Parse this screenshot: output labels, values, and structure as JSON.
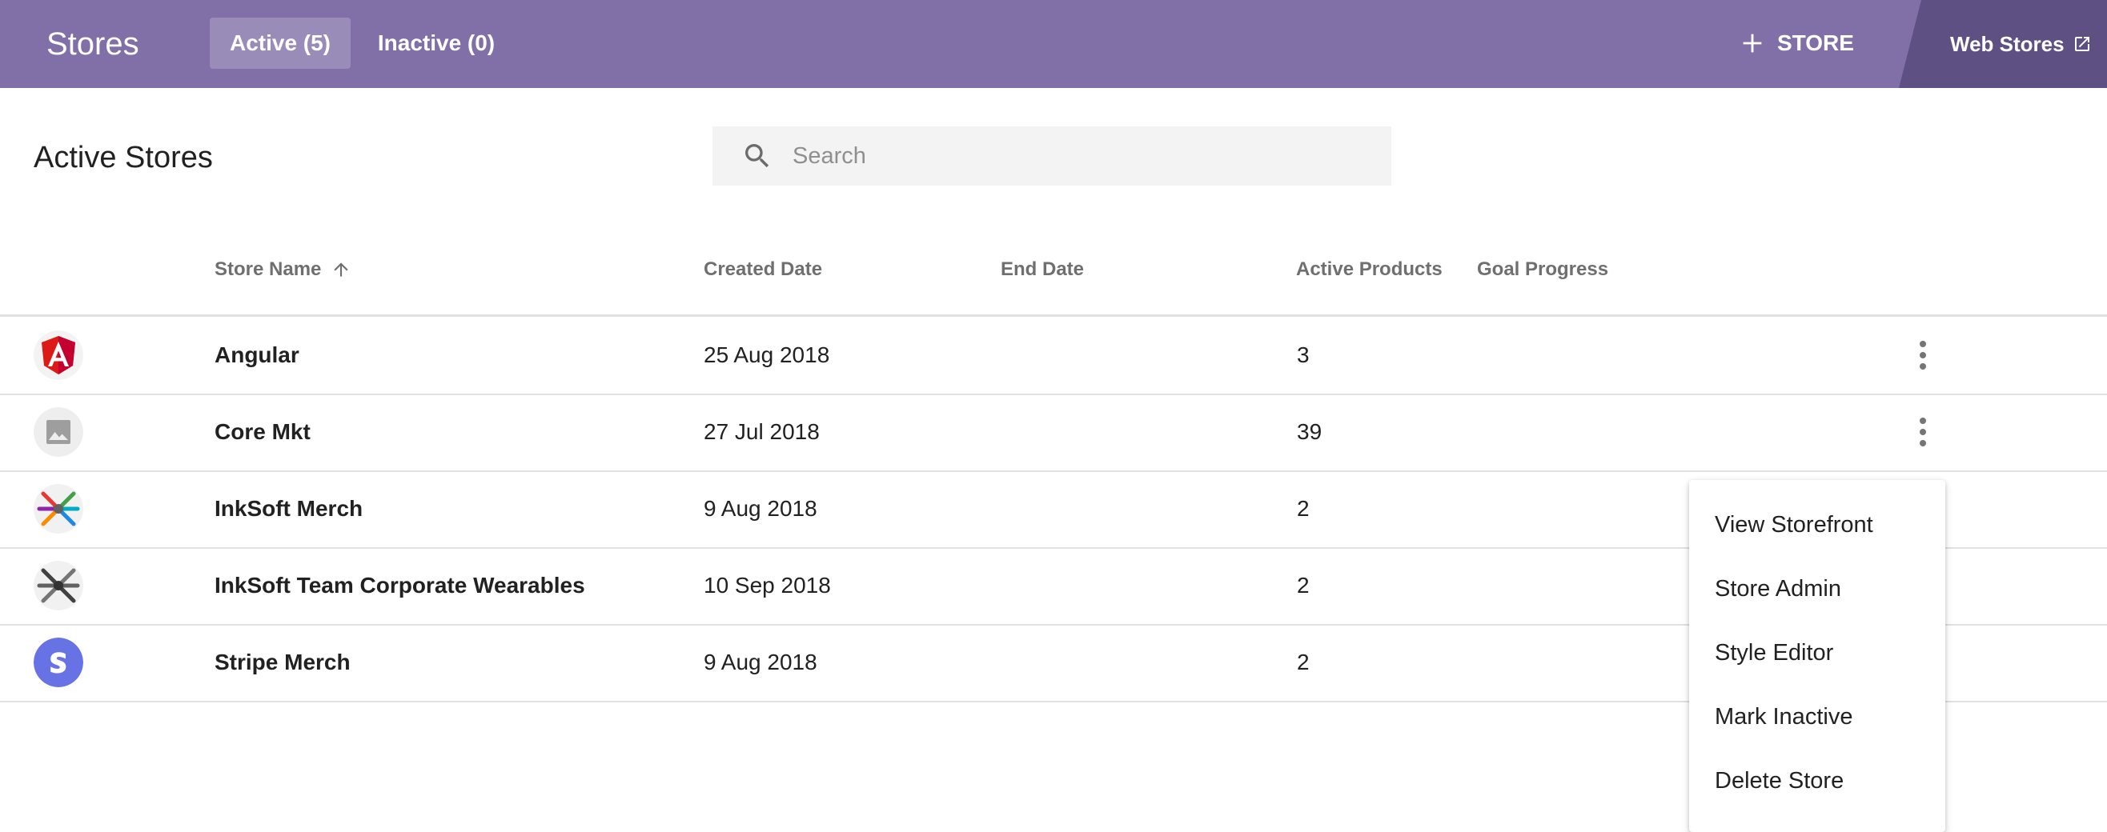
{
  "header": {
    "app_title": "Stores",
    "tabs": [
      {
        "label": "Active (5)",
        "selected": true
      },
      {
        "label": "Inactive (0)",
        "selected": false
      }
    ],
    "add_store_label": "STORE",
    "web_stores_label": "Web Stores",
    "brand_color": "#8170a8",
    "brand_dark_color": "#5e5082"
  },
  "main": {
    "title": "Active Stores",
    "search": {
      "placeholder": "Search",
      "value": ""
    }
  },
  "table": {
    "columns": {
      "store_name": "Store Name",
      "created_date": "Created Date",
      "end_date": "End Date",
      "active_products": "Active Products",
      "goal_progress": "Goal Progress"
    },
    "sort": {
      "column": "store_name",
      "direction": "ascending",
      "icon": "arrow-up-icon"
    },
    "rows": [
      {
        "name": "Angular",
        "created": "25 Aug 2018",
        "end": "",
        "products": "3",
        "goal": "",
        "logo": "angular-logo-icon"
      },
      {
        "name": "Core Mkt",
        "created": "27 Jul 2018",
        "end": "",
        "products": "39",
        "goal": "",
        "logo": "image-placeholder-icon"
      },
      {
        "name": "InkSoft Merch",
        "created": "9 Aug 2018",
        "end": "",
        "products": "2",
        "goal": "",
        "logo": "inksoft-color-logo-icon"
      },
      {
        "name": "InkSoft Team Corporate Wearables",
        "created": "10 Sep 2018",
        "end": "",
        "products": "2",
        "goal": "",
        "logo": "inksoft-gray-logo-icon"
      },
      {
        "name": "Stripe Merch",
        "created": "9 Aug 2018",
        "end": "",
        "products": "2",
        "goal": "",
        "logo": "stripe-logo-icon"
      }
    ]
  },
  "context_menu": {
    "items": [
      "View Storefront",
      "Store Admin",
      "Style Editor",
      "Mark Inactive",
      "Delete Store"
    ]
  }
}
